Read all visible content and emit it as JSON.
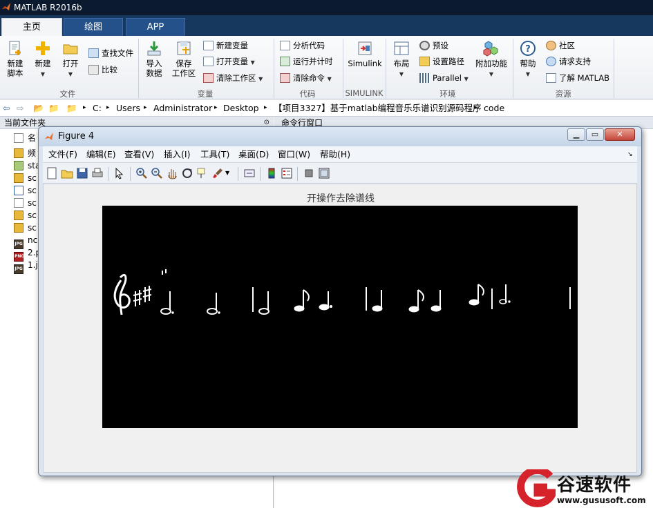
{
  "app": {
    "title": "MATLAB R2016b"
  },
  "tabs": [
    "主页",
    "绘图",
    "APP"
  ],
  "ribbon": {
    "new_script": "新建\n脚本",
    "new": "新建",
    "open": "打开",
    "find_files": "查找文件",
    "compare": "比较",
    "import_data": "导入\n数据",
    "save_workspace": "保存\n工作区",
    "new_variable": "新建变量",
    "open_variable": "打开变量",
    "clear_workspace": "清除工作区",
    "analyze_code": "分析代码",
    "run_and_time": "运行并计时",
    "clear_commands": "清除命令",
    "simulink": "Simulink",
    "layout": "布局",
    "preferences": "预设",
    "set_path": "设置路径",
    "parallel": "Parallel",
    "addons": "附加功能",
    "help": "帮助",
    "community": "社区",
    "request_support": "请求支持",
    "learn_matlab": "了解 MATLAB",
    "groups": [
      "文件",
      "变量",
      "代码",
      "SIMULINK",
      "环境",
      "资源"
    ]
  },
  "address": [
    "C:",
    "Users",
    "Administrator",
    "Desktop",
    "【项目3327】基于matlab编程音乐乐谱识别源码程序",
    "code"
  ],
  "left_panel": {
    "header": "当前文件夹",
    "files": [
      {
        "name": "名",
        "icon": "blank"
      },
      {
        "name": "频",
        "icon": "fig"
      },
      {
        "name": "sta",
        "icon": "mat"
      },
      {
        "name": "sc",
        "icon": "fig"
      },
      {
        "name": "sc",
        "icon": "m"
      },
      {
        "name": "sc",
        "icon": "blank"
      },
      {
        "name": "sc",
        "icon": "fig"
      },
      {
        "name": "sc",
        "icon": "fig"
      },
      {
        "name": "nc",
        "icon": "jpg"
      },
      {
        "name": "2.p",
        "icon": "png"
      },
      {
        "name": "1.j",
        "icon": "jpg"
      }
    ]
  },
  "cmd_panel": {
    "header": "命令行窗口"
  },
  "figure": {
    "title": "Figure 4",
    "menu": [
      "文件(F)",
      "编辑(E)",
      "查看(V)",
      "插入(I)",
      "工具(T)",
      "桌面(D)",
      "窗口(W)",
      "帮助(H)"
    ],
    "plot_title": "开操作去除谱线"
  },
  "watermark": {
    "brand": "谷速软件",
    "url": "www.gususoft.com"
  },
  "colors": {
    "accent": "#16385f",
    "titlebar": "#0b1a2e",
    "plot_bg": "#000000",
    "watermark_red": "#d6222a"
  }
}
